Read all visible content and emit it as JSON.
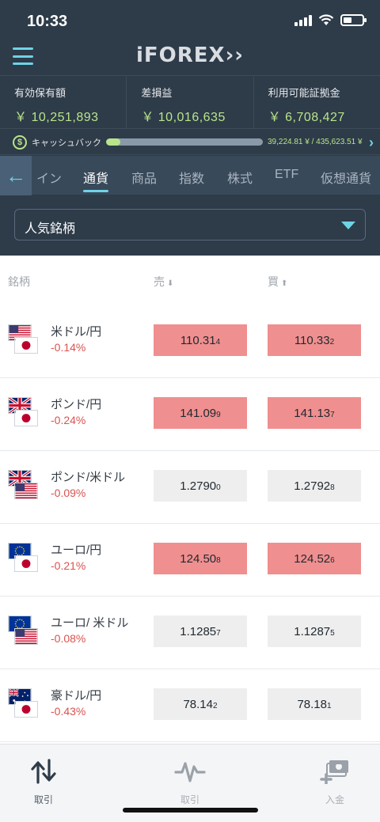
{
  "status": {
    "time": "10:33"
  },
  "app": {
    "logo": "iFOREX"
  },
  "stats": [
    {
      "label": "有効保有額",
      "value": "￥ 10,251,893"
    },
    {
      "label": "差損益",
      "value": "￥ 10,016,635"
    },
    {
      "label": "利用可能証拠金",
      "value": "￥ 6,708,427"
    }
  ],
  "cashback": {
    "label": "キャッシュバック",
    "amount": "39,224.81 ¥ / 435,623.51 ¥",
    "progress": 0.09
  },
  "tabs": [
    {
      "label": "イン"
    },
    {
      "label": "通貨"
    },
    {
      "label": "商品"
    },
    {
      "label": "指数"
    },
    {
      "label": "株式"
    },
    {
      "label": "ETF"
    },
    {
      "label": "仮想通貨"
    }
  ],
  "filter": {
    "selected": "人気銘柄"
  },
  "columns": {
    "symbol": "銘柄",
    "sell": "売",
    "buy": "買"
  },
  "rows": [
    {
      "name": "米ドル/円",
      "change": "-0.14%",
      "sell_main": "110.31",
      "sell_small": "4",
      "buy_main": "110.33",
      "buy_small": "2"
    },
    {
      "name": "ポンド/円",
      "change": "-0.24%",
      "sell_main": "141.09",
      "sell_small": "9",
      "buy_main": "141.13",
      "buy_small": "7"
    },
    {
      "name": "ポンド/米ドル",
      "change": "-0.09%",
      "sell_main": "1.2790",
      "sell_small": "0",
      "buy_main": "1.2792",
      "buy_small": "8"
    },
    {
      "name": "ユーロ/円",
      "change": "-0.21%",
      "sell_main": "124.50",
      "sell_small": "8",
      "buy_main": "124.52",
      "buy_small": "6"
    },
    {
      "name": "ユーロ/ 米ドル",
      "change": "-0.08%",
      "sell_main": "1.1285",
      "sell_small": "7",
      "buy_main": "1.1287",
      "buy_small": "5"
    },
    {
      "name": "豪ドル/円",
      "change": "-0.43%",
      "sell_main": "78.14",
      "sell_small": "2",
      "buy_main": "78.18",
      "buy_small": "1"
    }
  ],
  "tabbar": [
    {
      "label": "取引",
      "icon": "trade-arrows-icon"
    },
    {
      "label": "取引",
      "icon": "pulse-icon"
    },
    {
      "label": "入金",
      "icon": "deposit-icon"
    }
  ],
  "colors": {
    "header": "#2e3b49",
    "accent": "#6fd3e6",
    "positive": "#b9e48a",
    "negative": "#d9534f",
    "price_highlight": "#f08f8f"
  }
}
